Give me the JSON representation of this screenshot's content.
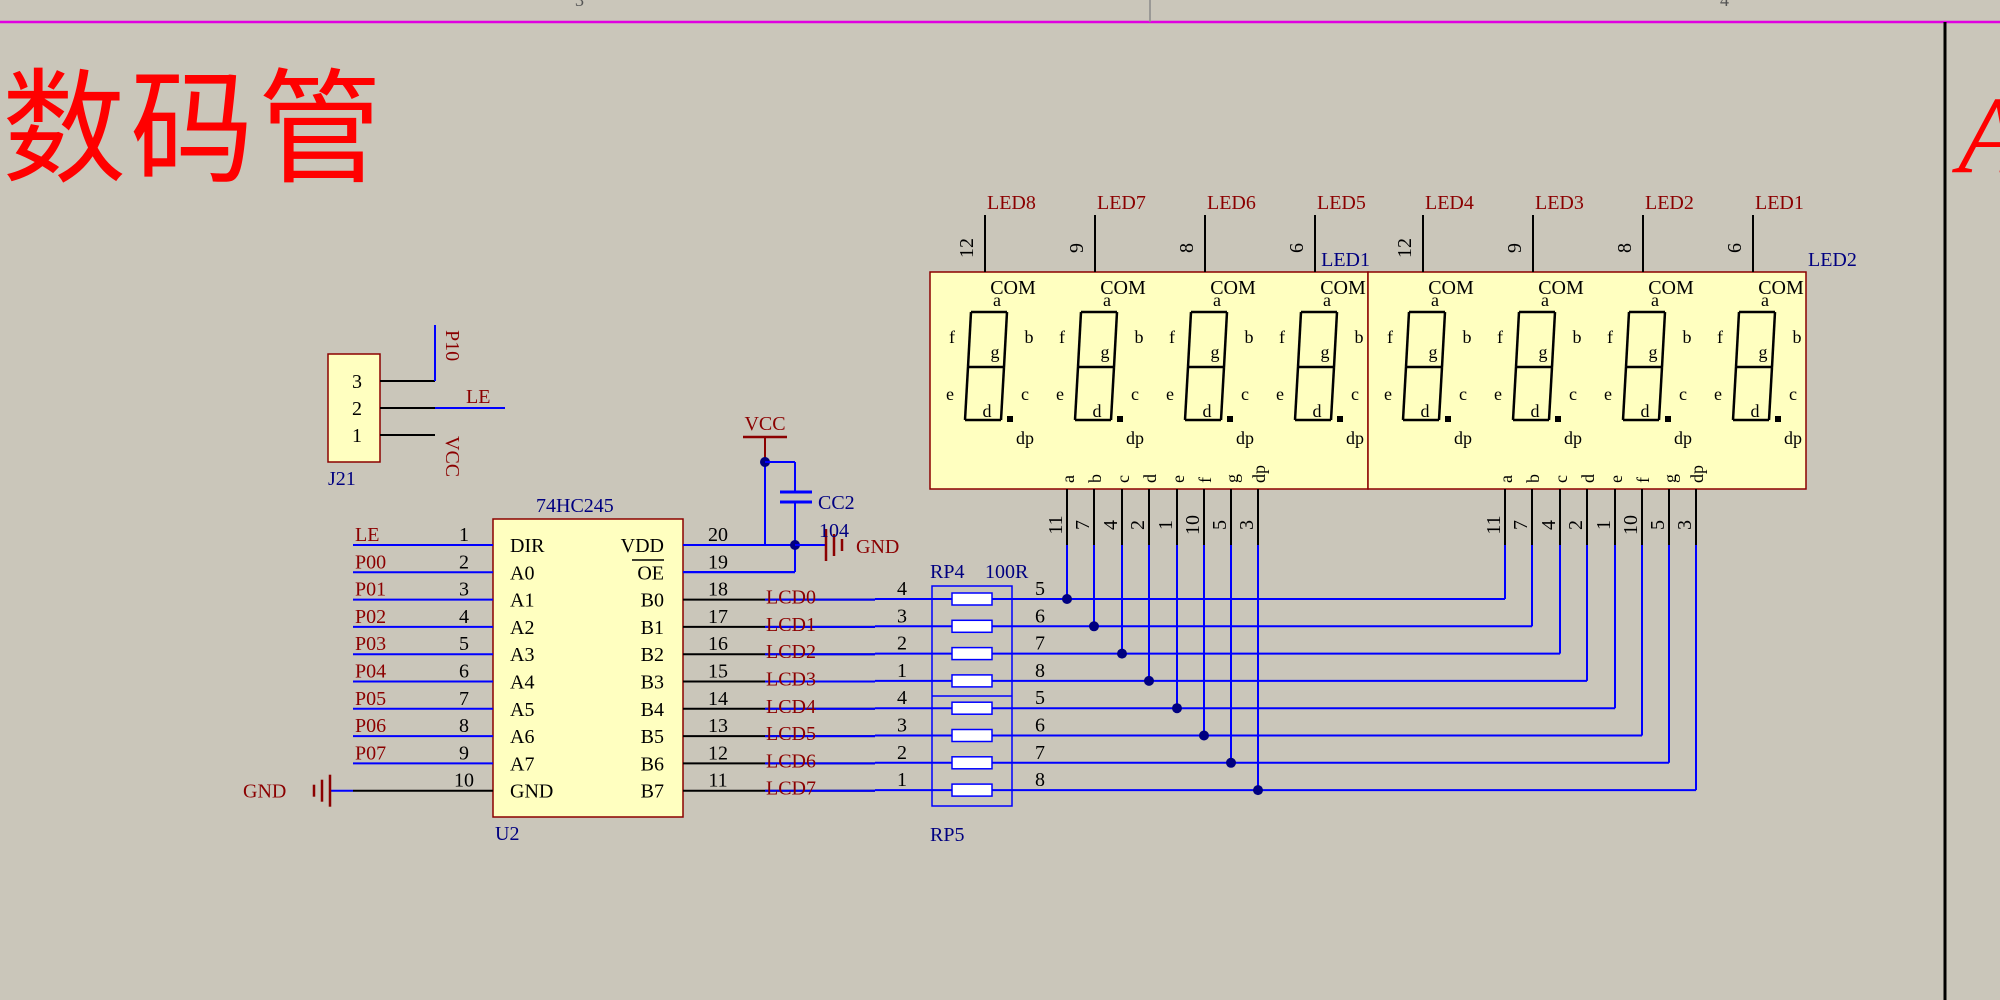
{
  "page": {
    "title": "数码管",
    "edge_letter": "A"
  },
  "header": {
    "col_left": "3",
    "col_right": "4"
  },
  "colors": {
    "background": "#cac6ba",
    "title": "#ff0000",
    "part_fill": "#ffffc0",
    "part_border": "#8b0000",
    "wire": "#0000ff",
    "net_label": "#8b0000",
    "designator": "#000080",
    "pin_text": "#000000",
    "frame": "#e000e0"
  },
  "connector": {
    "designator": "J21",
    "pins": [
      "3",
      "2",
      "1"
    ],
    "nets": [
      "P10",
      "LE",
      "VCC"
    ]
  },
  "ic": {
    "part": "74HC245",
    "designator": "U2",
    "left_pins": [
      {
        "num": "1",
        "name": "DIR",
        "net": "LE"
      },
      {
        "num": "2",
        "name": "A0",
        "net": "P00"
      },
      {
        "num": "3",
        "name": "A1",
        "net": "P01"
      },
      {
        "num": "4",
        "name": "A2",
        "net": "P02"
      },
      {
        "num": "5",
        "name": "A3",
        "net": "P03"
      },
      {
        "num": "6",
        "name": "A4",
        "net": "P04"
      },
      {
        "num": "7",
        "name": "A5",
        "net": "P05"
      },
      {
        "num": "8",
        "name": "A6",
        "net": "P06"
      },
      {
        "num": "9",
        "name": "A7",
        "net": "P07"
      },
      {
        "num": "10",
        "name": "GND",
        "net": ""
      }
    ],
    "right_pins": [
      {
        "num": "20",
        "name": "VDD",
        "net": ""
      },
      {
        "num": "19",
        "name": "OE",
        "net": ""
      },
      {
        "num": "18",
        "name": "B0",
        "net": "LCD0"
      },
      {
        "num": "17",
        "name": "B1",
        "net": "LCD1"
      },
      {
        "num": "16",
        "name": "B2",
        "net": "LCD2"
      },
      {
        "num": "15",
        "name": "B3",
        "net": "LCD3"
      },
      {
        "num": "14",
        "name": "B4",
        "net": "LCD4"
      },
      {
        "num": "13",
        "name": "B5",
        "net": "LCD5"
      },
      {
        "num": "12",
        "name": "B6",
        "net": "LCD6"
      },
      {
        "num": "11",
        "name": "B7",
        "net": "LCD7"
      }
    ],
    "gnd_label": "GND"
  },
  "capacitor": {
    "designator": "CC2",
    "value": "104",
    "vcc": "VCC",
    "gnd": "GND"
  },
  "resistor_packs": [
    {
      "designator": "RP4",
      "value": "100R",
      "left_pins": [
        "4",
        "3",
        "2",
        "1"
      ],
      "right_pins": [
        "5",
        "6",
        "7",
        "8"
      ]
    },
    {
      "designator": "RP5",
      "value": "",
      "left_pins": [
        "4",
        "3",
        "2",
        "1"
      ],
      "right_pins": [
        "5",
        "6",
        "7",
        "8"
      ]
    }
  ],
  "displays": [
    {
      "designator": "LED1",
      "com_nets": [
        "LED8",
        "LED7",
        "LED6",
        "LED5"
      ],
      "com_pins": [
        "12",
        "9",
        "8",
        "6"
      ],
      "seg_names": [
        "a",
        "b",
        "c",
        "d",
        "e",
        "f",
        "g",
        "dp"
      ],
      "seg_pins": [
        "11",
        "7",
        "4",
        "2",
        "1",
        "10",
        "5",
        "3"
      ]
    },
    {
      "designator": "LED2",
      "com_nets": [
        "LED4",
        "LED3",
        "LED2",
        "LED1"
      ],
      "com_pins": [
        "12",
        "9",
        "8",
        "6"
      ],
      "seg_names": [
        "a",
        "b",
        "c",
        "d",
        "e",
        "f",
        "g",
        "dp"
      ],
      "seg_pins": [
        "11",
        "7",
        "4",
        "2",
        "1",
        "10",
        "5",
        "3"
      ]
    }
  ],
  "digit_labels": {
    "com": "COM",
    "a": "a",
    "b": "b",
    "c": "c",
    "d": "d",
    "e": "e",
    "f": "f",
    "g": "g",
    "dp": "dp"
  }
}
